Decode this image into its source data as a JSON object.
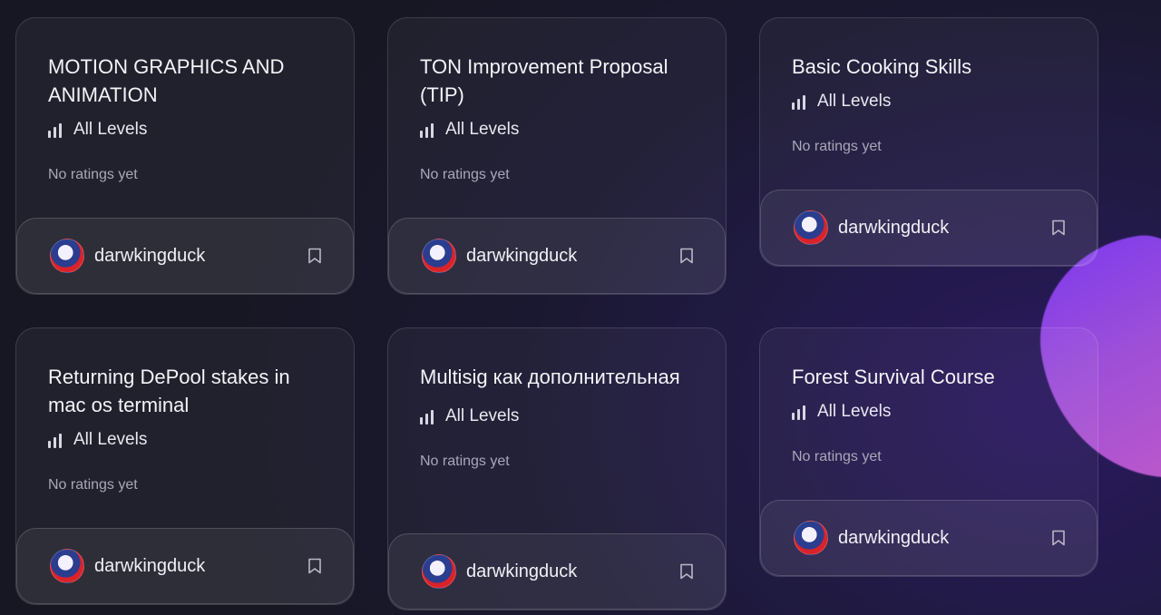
{
  "courses": [
    {
      "title": "MOTION GRAPHICS AND ANIMATION",
      "level": "All Levels",
      "rating": "No ratings yet",
      "author": "darwkingduck"
    },
    {
      "title": "TON Improvement Proposal (TIP)",
      "level": "All Levels",
      "rating": "No ratings yet",
      "author": "darwkingduck"
    },
    {
      "title": "Basic Cooking Skills",
      "level": "All Levels",
      "rating": "No ratings yet",
      "author": "darwkingduck"
    },
    {
      "title": "Returning DePool stakes in mac os terminal",
      "level": "All Levels",
      "rating": "No ratings yet",
      "author": "darwkingduck"
    },
    {
      "title": "Multisig как дополнительная",
      "level": "All Levels",
      "rating": "No ratings yet",
      "author": "darwkingduck"
    },
    {
      "title": "Forest Survival Course",
      "level": "All Levels",
      "rating": "No ratings yet",
      "author": "darwkingduck"
    }
  ],
  "icons": {
    "level": "bar-chart-icon",
    "bookmark": "bookmark-icon",
    "avatar": "duck-avatar"
  },
  "colors": {
    "background": "#171724",
    "accent_blob": "#9d4fd8"
  }
}
